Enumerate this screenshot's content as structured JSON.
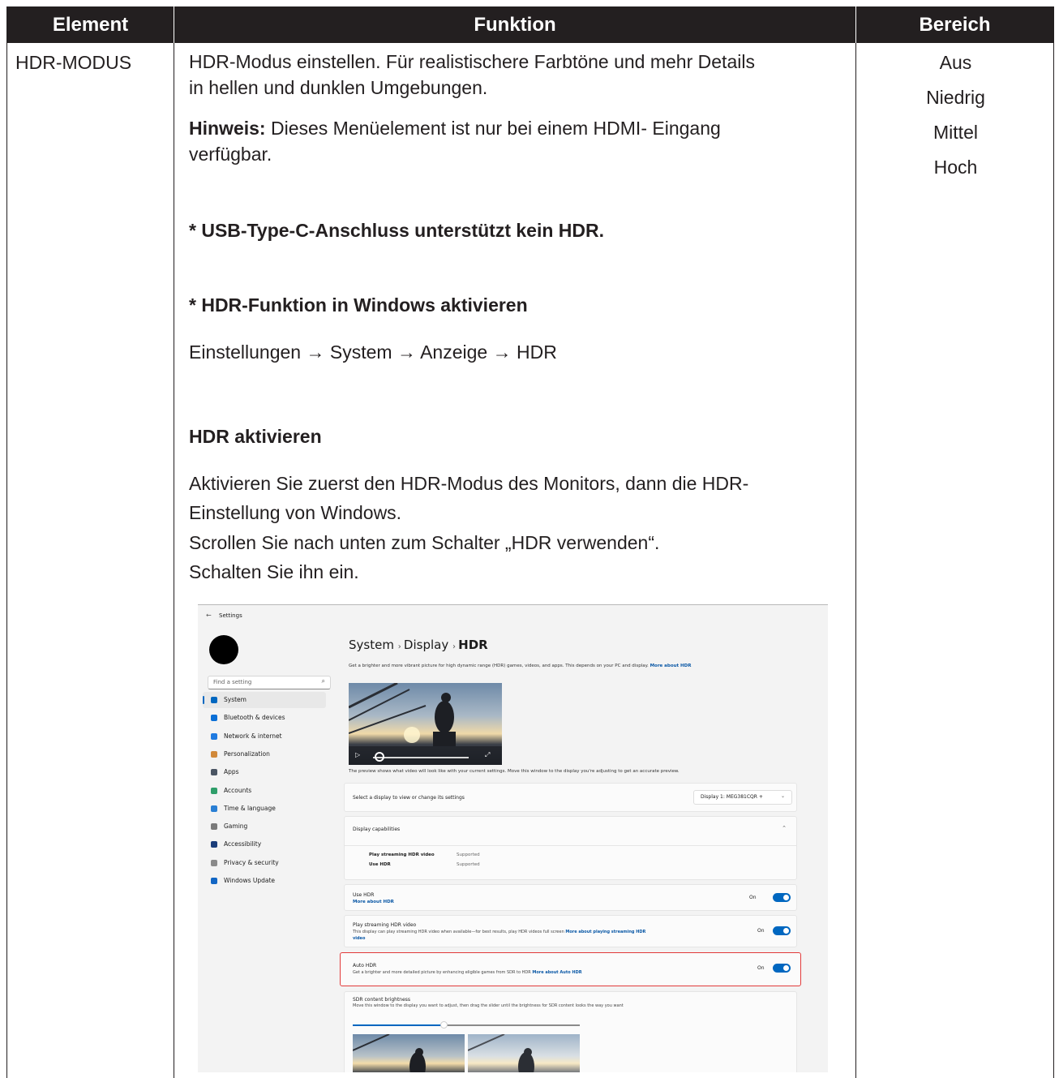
{
  "table": {
    "headers": [
      "Element",
      "Funktion",
      "Bereich"
    ],
    "element": "HDR-MODUS",
    "ranges": [
      "Aus",
      "Niedrig",
      "Mittel",
      "Hoch"
    ],
    "func": {
      "line1": "HDR-Modus einstellen. Für realistischere Farbtöne und mehr Details",
      "line2": "in hellen und dunklen Umgebungen.",
      "note_label": "Hinweis:",
      "note_text": " Dieses Menüelement ist nur bei einem HDMI- Eingang",
      "note_line2": "verfügbar.",
      "usb": "* USB-Type-C-Anschluss unterstützt kein HDR.",
      "win": "* HDR-Funktion in Windows aktivieren",
      "path": "Einstellungen → System → Anzeige → HDR",
      "activate_title": "HDR aktivieren",
      "p1": "Aktivieren Sie zuerst den HDR-Modus des Monitors, dann die HDR-",
      "p2": "Einstellung von Windows.",
      "p3": "Scrollen Sie nach unten zum Schalter „HDR verwenden“.",
      "p4": "Schalten Sie ihn ein."
    }
  },
  "screenshot": {
    "back": "Settings",
    "search_placeholder": "Find a setting",
    "nav": [
      "System",
      "Bluetooth & devices",
      "Network & internet",
      "Personalization",
      "Apps",
      "Accounts",
      "Time & language",
      "Gaming",
      "Accessibility",
      "Privacy & security",
      "Windows Update"
    ],
    "nav_colors": [
      "#0067c0",
      "#0a6fd6",
      "#1f7ae0",
      "#d1893a",
      "#4a5563",
      "#2f9e6a",
      "#2a7fd4",
      "#7a7a7a",
      "#1b3d7a",
      "#8a8a8a",
      "#1266c4"
    ],
    "breadcrumb": [
      "System",
      "Display",
      "HDR"
    ],
    "description": "Get a brighter and more vibrant picture for high dynamic range (HDR) games, videos, and apps. This depends on your PC and display.",
    "description_link": "More about HDR",
    "preview_note": "The preview shows what video will look like with your current settings. Move this window to the display you're adjusting to get an accurate preview.",
    "select_display": "Select a display to view or change its settings",
    "display_value": "Display 1: MEG381CQR +",
    "capabilities": "Display capabilities",
    "cap_rows": [
      {
        "name": "Play streaming HDR video",
        "value": "Supported"
      },
      {
        "name": "Use HDR",
        "value": "Supported"
      }
    ],
    "use_hdr": "Use HDR",
    "use_hdr_link": "More about HDR",
    "play_streaming": "Play streaming HDR video",
    "play_streaming_desc": "This display can play streaming HDR video when available—for best results, play HDR videos full screen",
    "play_streaming_link": "More about playing streaming HDR",
    "play_streaming_link2": "video",
    "auto_hdr": "Auto HDR",
    "auto_hdr_desc": "Get a brighter and more detailed picture by enhancing eligible games from SDR to HDR",
    "auto_hdr_link": "More about Auto HDR",
    "on_label": "On",
    "sdr_title": "SDR content brightness",
    "sdr_desc": "Move this window to the display you want to adjust, then drag the slider until the brightness for SDR content looks the way you want",
    "sdr_slider_value": 0.4
  }
}
